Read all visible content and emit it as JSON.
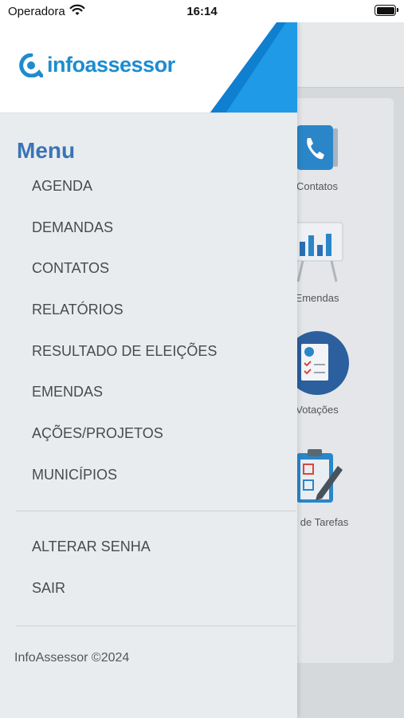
{
  "status_bar": {
    "carrier": "Operadora",
    "time": "16:14"
  },
  "brand": {
    "logo_text": "infoassessor",
    "primary_color": "#1d8ccf",
    "accent_color": "#3a74b5"
  },
  "menu": {
    "title": "Menu",
    "items": [
      {
        "label": "AGENDA"
      },
      {
        "label": "DEMANDAS"
      },
      {
        "label": "CONTATOS"
      },
      {
        "label": "RELATÓRIOS"
      },
      {
        "label": "RESULTADO DE ELEIÇÕES"
      },
      {
        "label": "EMENDAS"
      },
      {
        "label": "AÇÕES/PROJETOS"
      },
      {
        "label": "MUNICÍPIOS"
      }
    ],
    "account_items": [
      {
        "label": "ALTERAR SENHA"
      },
      {
        "label": "SAIR"
      }
    ],
    "footer": "InfoAssessor ©2024"
  },
  "background_tiles": [
    {
      "label": "Contatos",
      "icon": "phone-book-icon"
    },
    {
      "label": "Emendas",
      "icon": "bar-chart-board-icon"
    },
    {
      "label": "Votações",
      "icon": "report-document-icon"
    },
    {
      "label": "ão de Tarefas",
      "icon": "clipboard-pencil-icon"
    }
  ]
}
